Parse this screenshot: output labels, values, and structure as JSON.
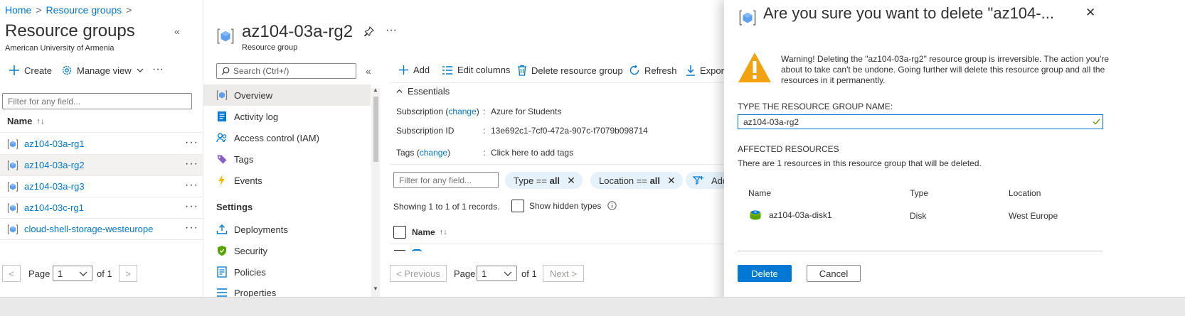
{
  "breadcrumb": {
    "home": "Home",
    "resource_groups": "Resource groups",
    "separator": ">"
  },
  "left": {
    "title": "Resource groups",
    "subtitle": "American University of Armenia",
    "collapse": "«",
    "commands": {
      "create": "Create",
      "manage_view": "Manage view",
      "more": "···"
    },
    "filter_placeholder": "Filter for any field...",
    "column_name": "Name",
    "sort_indicator": "↑↓",
    "rows": [
      {
        "name": "az104-03a-rg1",
        "more": "···"
      },
      {
        "name": "az104-03a-rg2",
        "more": "···"
      },
      {
        "name": "az104-03a-rg3",
        "more": "···"
      },
      {
        "name": "az104-03c-rg1",
        "more": "···"
      },
      {
        "name": "cloud-shell-storage-westeurope",
        "more": "···"
      }
    ],
    "pager": {
      "prev": "<",
      "page_label": "Page",
      "page_value": "1",
      "of": "of 1",
      "next": ">"
    }
  },
  "middle": {
    "title": "az104-03a-rg2",
    "subtitle": "Resource group",
    "pin": "pin-icon",
    "more": "···",
    "search_placeholder": "Search (Ctrl+/)",
    "collapse": "«",
    "menu": [
      {
        "label": "Overview",
        "icon": "resource-group-icon"
      },
      {
        "label": "Activity log",
        "icon": "activity-log-icon"
      },
      {
        "label": "Access control (IAM)",
        "icon": "iam-icon"
      },
      {
        "label": "Tags",
        "icon": "tag-icon"
      },
      {
        "label": "Events",
        "icon": "lightning-icon"
      }
    ],
    "settings_header": "Settings",
    "settings_menu": [
      {
        "label": "Deployments",
        "icon": "deployments-icon"
      },
      {
        "label": "Security",
        "icon": "shield-icon"
      },
      {
        "label": "Policies",
        "icon": "policy-icon"
      },
      {
        "label": "Properties",
        "icon": "properties-icon"
      }
    ],
    "toolbar": {
      "add": "Add",
      "edit_columns": "Edit columns",
      "delete_rg": "Delete resource group",
      "refresh": "Refresh",
      "export": "Export"
    },
    "essentials": {
      "header": "Essentials",
      "subscription_label": "Subscription",
      "change": "change",
      "subscription_value": "Azure for Students",
      "subscription_id_label": "Subscription ID",
      "subscription_id_value": "13e692c1-7cf0-472a-907c-f7079b098714",
      "tags_label": "Tags",
      "tags_value": "Click here to add tags",
      "colon": ":"
    },
    "filter_placeholder": "Filter for any field...",
    "pills": [
      {
        "key": "Type == ",
        "value": "all"
      },
      {
        "key": "Location == ",
        "value": "all"
      }
    ],
    "add_filter": "Add",
    "showing": "Showing 1 to 1 of 1 records.",
    "show_hidden": "Show hidden types",
    "column_name": "Name",
    "sort_indicator": "↑↓",
    "pager": {
      "prev": "< Previous",
      "page_label": "Page",
      "page_value": "1",
      "of": "of 1",
      "next": "Next >"
    }
  },
  "dialog": {
    "title": "Are you sure you want to delete \"az104-...",
    "close": "✕",
    "warning": "Warning! Deleting the \"az104-03a-rg2\" resource group is irreversible. The action you're about to take can't be undone. Going further will delete this resource group and all the resources in it permanently.",
    "type_label": "TYPE THE RESOURCE GROUP NAME:",
    "input_value": "az104-03a-rg2",
    "affected_header": "AFFECTED RESOURCES",
    "affected_desc": "There are 1 resources in this resource group that will be deleted.",
    "table_headers": {
      "name": "Name",
      "type": "Type",
      "location": "Location"
    },
    "resources": [
      {
        "name": "az104-03a-disk1",
        "type": "Disk",
        "location": "West Europe"
      }
    ],
    "delete_button": "Delete",
    "cancel_button": "Cancel"
  },
  "colors": {
    "accent": "#0078d4",
    "text": "#323130",
    "warning": "#f2a20f",
    "valid": "#57a300"
  }
}
